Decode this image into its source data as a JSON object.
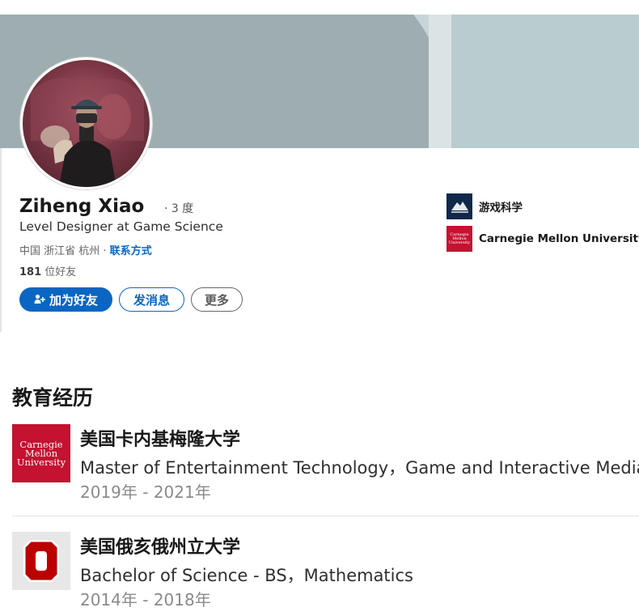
{
  "profile": {
    "name": "Ziheng Xiao",
    "degree": "· 3 度",
    "headline": "Level Designer at Game Science",
    "location": "中国 浙江省 杭州",
    "location_sep": " · ",
    "contact_label": "联系方式",
    "connections_count": "181",
    "connections_label": " 位好友"
  },
  "actions": {
    "connect_label": "加为好友",
    "message_label": "发消息",
    "more_label": "更多"
  },
  "orgs": [
    {
      "name": "游戏科学",
      "logo": "game-science-logo"
    },
    {
      "name": "Carnegie Mellon University",
      "logo": "cmu-logo",
      "logo_lines": [
        "Carnegie",
        "Mellon",
        "University"
      ]
    }
  ],
  "education": {
    "title": "教育经历",
    "items": [
      {
        "school": "美国卡内基梅隆大学",
        "degree": "Master of Entertainment Technology，Game and Interactive Media",
        "years": "2019年 - 2021年",
        "logo": "cmu-logo",
        "logo_lines": [
          "Carnegie",
          "Mellon",
          "University"
        ]
      },
      {
        "school": "美国俄亥俄州立大学",
        "degree": "Bachelor of Science - BS，Mathematics",
        "years": "2014年 - 2018年",
        "logo": "ohio-state-block-o-logo"
      }
    ]
  },
  "colors": {
    "primary": "#0a66c2",
    "cmu_red": "#c41230",
    "osu_scarlet": "#bb0000",
    "banner": "#9eaeb0"
  }
}
